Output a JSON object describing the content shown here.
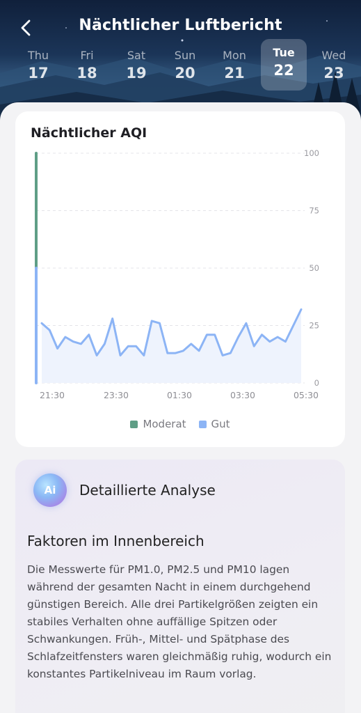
{
  "header": {
    "title": "Nächtlicher Luftbericht",
    "days": [
      {
        "name": "Thu",
        "date": "17",
        "selected": false
      },
      {
        "name": "Fri",
        "date": "18",
        "selected": false
      },
      {
        "name": "Sat",
        "date": "19",
        "selected": false
      },
      {
        "name": "Sun",
        "date": "20",
        "selected": false
      },
      {
        "name": "Mon",
        "date": "21",
        "selected": false
      },
      {
        "name": "Tue",
        "date": "22",
        "selected": true
      },
      {
        "name": "Wed",
        "date": "23",
        "selected": false
      }
    ]
  },
  "chart_card": {
    "title": "Nächtlicher AQI"
  },
  "chart_data": {
    "type": "area",
    "title": "Nächtlicher AQI",
    "y_ticks": [
      "100",
      "75",
      "50",
      "25",
      "0"
    ],
    "ylim": [
      0,
      100
    ],
    "x_ticks": [
      "21:30",
      "23:30",
      "01:30",
      "03:30",
      "05:30"
    ],
    "grid": true,
    "legend_position": "bottom",
    "series": [
      {
        "name": "Gut",
        "color": "#8cb4f5",
        "values": [
          26,
          23,
          15,
          20,
          18,
          17,
          21,
          12,
          17,
          28,
          12,
          16,
          16,
          12,
          27,
          26,
          13,
          13,
          14,
          17,
          14,
          21,
          21,
          12,
          13,
          20,
          26,
          16,
          21,
          18,
          20,
          18,
          25,
          32
        ]
      }
    ],
    "level_bar": [
      {
        "name": "Moderat",
        "color": "#5f9e86",
        "from": 50,
        "to": 100
      },
      {
        "name": "Gut",
        "color": "#8cb4f5",
        "from": 0,
        "to": 50
      }
    ]
  },
  "legend": [
    {
      "label": "Moderat",
      "color": "#5f9e86"
    },
    {
      "label": "Gut",
      "color": "#8cb4f5"
    }
  ],
  "analysis": {
    "badge": "Ai",
    "title": "Detaillierte Analyse",
    "section_heading": "Faktoren im Innenbereich",
    "body": "Die Messwerte für PM1.0, PM2.5 und PM10 lagen während der gesamten Nacht in einem durchgehend günstigen Bereich. Alle drei Partikelgrößen zeigten ein stabiles Verhalten ohne auffällige Spitzen oder Schwankungen. Früh-, Mittel- und Spätphase des Schlafzeitfensters waren gleichmäßig ruhig, wodurch ein konstantes Partikelniveau im Raum vorlag."
  },
  "icons": {
    "back": "chevron-left-icon",
    "ai": "ai-badge-icon"
  }
}
